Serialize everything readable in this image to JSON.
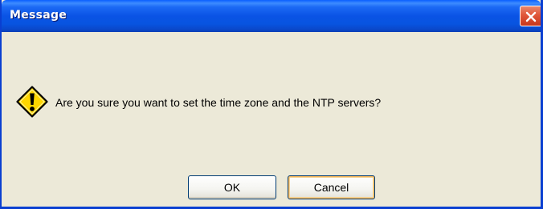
{
  "window": {
    "title": "Message"
  },
  "dialog": {
    "icon": "warning-exclamation-icon",
    "message": "Are you sure you want to set the time zone and the NTP servers?"
  },
  "buttons": {
    "ok_label": "OK",
    "cancel_label": "Cancel"
  },
  "colors": {
    "titlebar_blue": "#0a53e5",
    "dialog_background": "#ece9d8",
    "close_red": "#e0573a",
    "warning_yellow": "#ffd600",
    "focus_orange": "#f9b85a"
  }
}
